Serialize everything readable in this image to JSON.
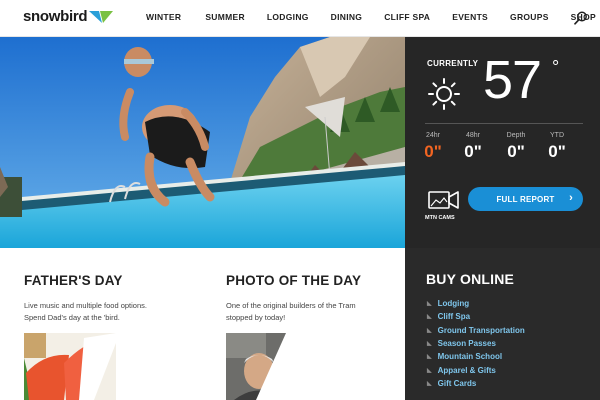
{
  "header": {
    "logo": "snowbird",
    "nav": [
      "WINTER",
      "SUMMER",
      "LODGING",
      "DINING",
      "CLIFF SPA",
      "EVENTS",
      "GROUPS",
      "SHOP"
    ]
  },
  "weather": {
    "currently_label": "CURRENTLY",
    "temperature": "57",
    "unit": "°",
    "snow": [
      {
        "label": "24hr",
        "value": "0\"",
        "highlight": true
      },
      {
        "label": "48hr",
        "value": "0\"",
        "highlight": false
      },
      {
        "label": "Depth",
        "value": "0\"",
        "highlight": false
      },
      {
        "label": "YTD",
        "value": "0\"",
        "highlight": false
      }
    ],
    "cams_label": "MTN CAMS",
    "full_report": "FULL REPORT"
  },
  "cards": [
    {
      "title": "FATHER'S DAY",
      "text_line1": "Live music and multiple food options.",
      "text_line2": "Spend Dad's day at the 'bird."
    },
    {
      "title": "PHOTO OF THE DAY",
      "text_line1": "One of the original builders of the Tram",
      "text_line2": "stopped by today!"
    }
  ],
  "buy_online": {
    "title": "BUY ONLINE",
    "items": [
      "Lodging",
      "Cliff Spa",
      "Ground Transportation",
      "Season Passes",
      "Mountain School",
      "Apparel & Gifts",
      "Gift Cards"
    ]
  },
  "colors": {
    "accent_blue": "#1a8fd6",
    "accent_orange": "#f26522",
    "link_blue": "#7fc6ec",
    "dark_panel": "#262626"
  }
}
